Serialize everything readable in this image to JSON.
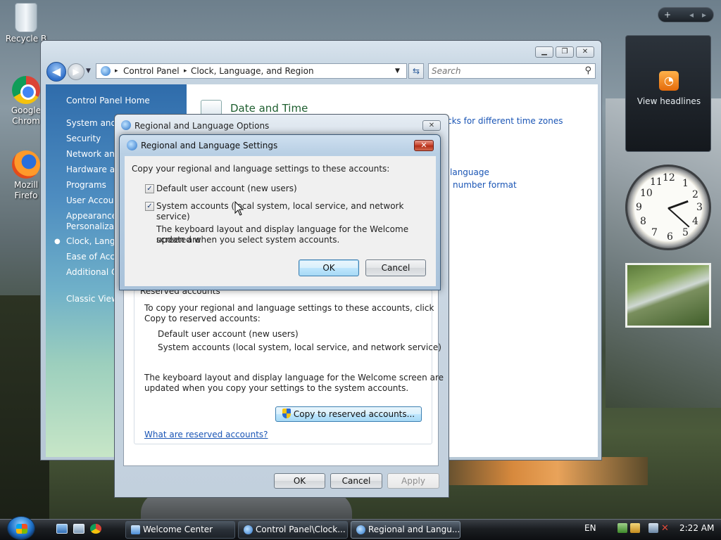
{
  "desktop": {
    "icons": [
      {
        "label": "Recycle B"
      },
      {
        "label": "Google Chrom"
      },
      {
        "label": "Mozill Firefo"
      }
    ]
  },
  "gadgets": {
    "rss_label": "View headlines",
    "clock_numbers": [
      "12",
      "1",
      "2",
      "3",
      "4",
      "5",
      "6",
      "7",
      "8",
      "9",
      "10",
      "11"
    ],
    "clock_time": "2:22"
  },
  "control_panel": {
    "breadcrumb": [
      "Control Panel",
      "Clock, Language, and Region"
    ],
    "search_placeholder": "Search",
    "nav": {
      "home": "Control Panel Home",
      "items": [
        "System and M",
        "Security",
        "Network and",
        "Hardware an",
        "Programs",
        "User Accoun",
        "Appearance a",
        "Personalizati",
        "Clock, Langu",
        "Ease of Acces",
        "Additional O"
      ],
      "classic_view": "Classic View"
    },
    "content": {
      "heading": "Date and Time",
      "task_clocks": "cks for different time zones",
      "task_language": "language",
      "task_number": "number format"
    }
  },
  "regional_options": {
    "title": "Regional and Language Options",
    "group_label": "Reserved accounts",
    "copy_text_1": "To copy your regional and language settings to these accounts, click",
    "copy_text_2": "Copy to reserved accounts:",
    "account_1": "Default user account (new users)",
    "account_2": "System accounts (local system, local service, and network service)",
    "welcome_text_1": "The keyboard layout and display language for the Welcome screen are",
    "welcome_text_2": "updated when you copy your settings to the system accounts.",
    "copy_button": "Copy to reserved accounts...",
    "reserved_link": "What are reserved accounts?",
    "ok": "OK",
    "cancel": "Cancel",
    "apply": "Apply"
  },
  "regional_settings": {
    "title": "Regional and Language Settings",
    "intro": "Copy your regional and language settings to these accounts:",
    "checkbox_default": "Default user account (new users)",
    "checkbox_system": "System accounts (local system, local service, and network service)",
    "checkbox_default_checked": true,
    "checkbox_system_checked": true,
    "note_1": "The keyboard layout and display language for the Welcome screen are",
    "note_2": "updated when you select system accounts.",
    "ok": "OK",
    "cancel": "Cancel"
  },
  "taskbar": {
    "buttons": [
      "Welcome Center",
      "Control Panel\\Clock...",
      "Regional and Langu..."
    ],
    "language": "EN",
    "time": "2:22 AM"
  },
  "colors": {
    "link": "#1a55b5",
    "heading_green": "#1e5e2f",
    "close_red": "#c6402a"
  }
}
